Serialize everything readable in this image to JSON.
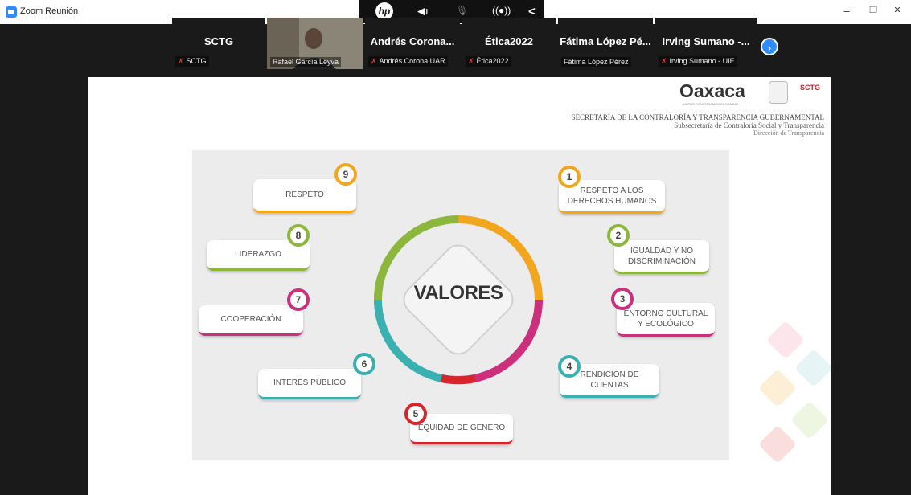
{
  "window": {
    "title": "Zoom Reunión",
    "minimize": "–",
    "maximize": "❐",
    "close": "✕"
  },
  "controls": {
    "hp": "hp",
    "speaker": "◀ı",
    "mic": "🎙",
    "broadcast": "((●))",
    "collapse": "<"
  },
  "participants": [
    {
      "name": "SCTG",
      "label": "SCTG",
      "muted": true
    },
    {
      "name": "",
      "label": "Rafael García Leyva",
      "muted": false
    },
    {
      "name": "Andrés Corona...",
      "label": "Andrés Corona UAR",
      "muted": true
    },
    {
      "name": "Ética2022",
      "label": "Ética2022",
      "muted": true
    },
    {
      "name": "Fátima López Pé...",
      "label": "Fátima López Pérez",
      "muted": false
    },
    {
      "name": "Irving Sumano -...",
      "label": "Irving Sumano - UIE",
      "muted": true
    }
  ],
  "next_arrow": "›",
  "slide": {
    "logo_text": "Oaxaca",
    "logo_tagline": "JUNTOS CONSTRUIMOS EL CAMBIO",
    "sctg_logo": "SCTG",
    "header_line1": "SECRETARÍA DE LA CONTRALORÍA Y TRANSPARENCIA GUBERNAMENTAL",
    "header_line2": "Subsecretaría de Contraloría Social y Transparencia",
    "header_line3": "Dirección de Transparencia",
    "center_title": "VALORES",
    "values": [
      {
        "num": "1",
        "text": "RESPETO A LOS DERECHOS HUMANOS",
        "color": "#f2a61d"
      },
      {
        "num": "2",
        "text": "IGUALDAD Y NO DISCRIMINACIÓN",
        "color": "#8cb63c"
      },
      {
        "num": "3",
        "text": "ENTORNO CULTURAL Y ECOLÓGICO",
        "color": "#cc2f7b"
      },
      {
        "num": "4",
        "text": "RENDICIÓN DE CUENTAS",
        "color": "#3ab0b0"
      },
      {
        "num": "5",
        "text": "EQUIDAD DE GENERO",
        "color": "#d9252a"
      },
      {
        "num": "6",
        "text": "INTERÉS PÚBLICO",
        "color": "#3ab0b0"
      },
      {
        "num": "7",
        "text": "COOPERACIÓN",
        "color": "#cc2f7b"
      },
      {
        "num": "8",
        "text": "LIDERAZGO",
        "color": "#8cb63c"
      },
      {
        "num": "9",
        "text": "RESPETO",
        "color": "#f2a61d"
      }
    ]
  },
  "colors": {
    "accent": "#2d8cff",
    "mute": "#e0393e"
  }
}
